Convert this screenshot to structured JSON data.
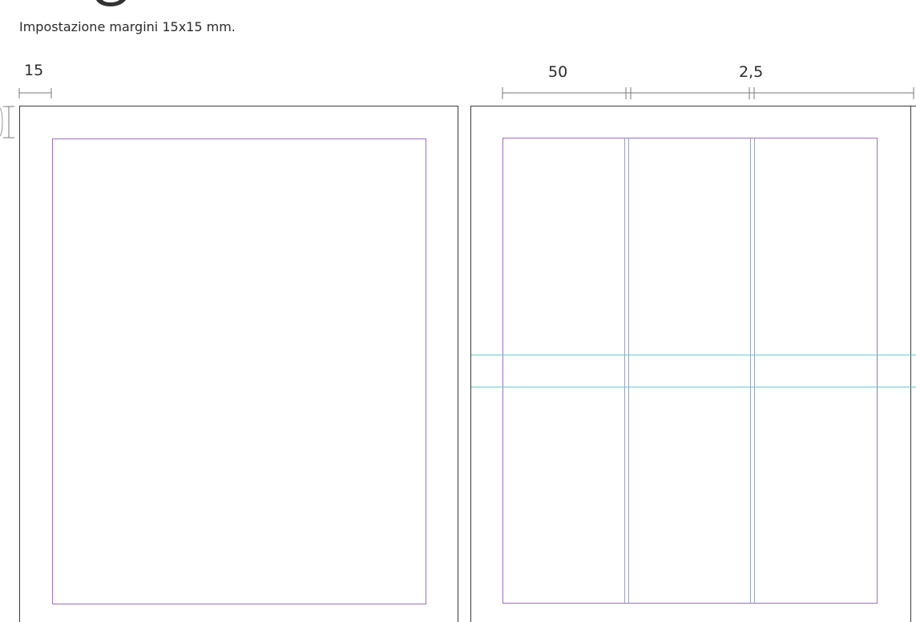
{
  "heading": {
    "visible_fragment": "g"
  },
  "subtitle": "Impostazione margini 15x15 mm.",
  "dimensions": {
    "margin": "15",
    "column_width": "50",
    "gutter": "2,5"
  },
  "layout": {
    "left_page_columns": 1,
    "right_page_columns": 3,
    "right_page_horizontal_guides": 2
  },
  "colors": {
    "page_border": "#3a3a3a",
    "margin_guide": "#9b6fc4",
    "column_guide": "#9aa0c0",
    "horizontal_guide": "#5fcfc9",
    "dimension_line": "#777777",
    "heading": "#333333"
  }
}
